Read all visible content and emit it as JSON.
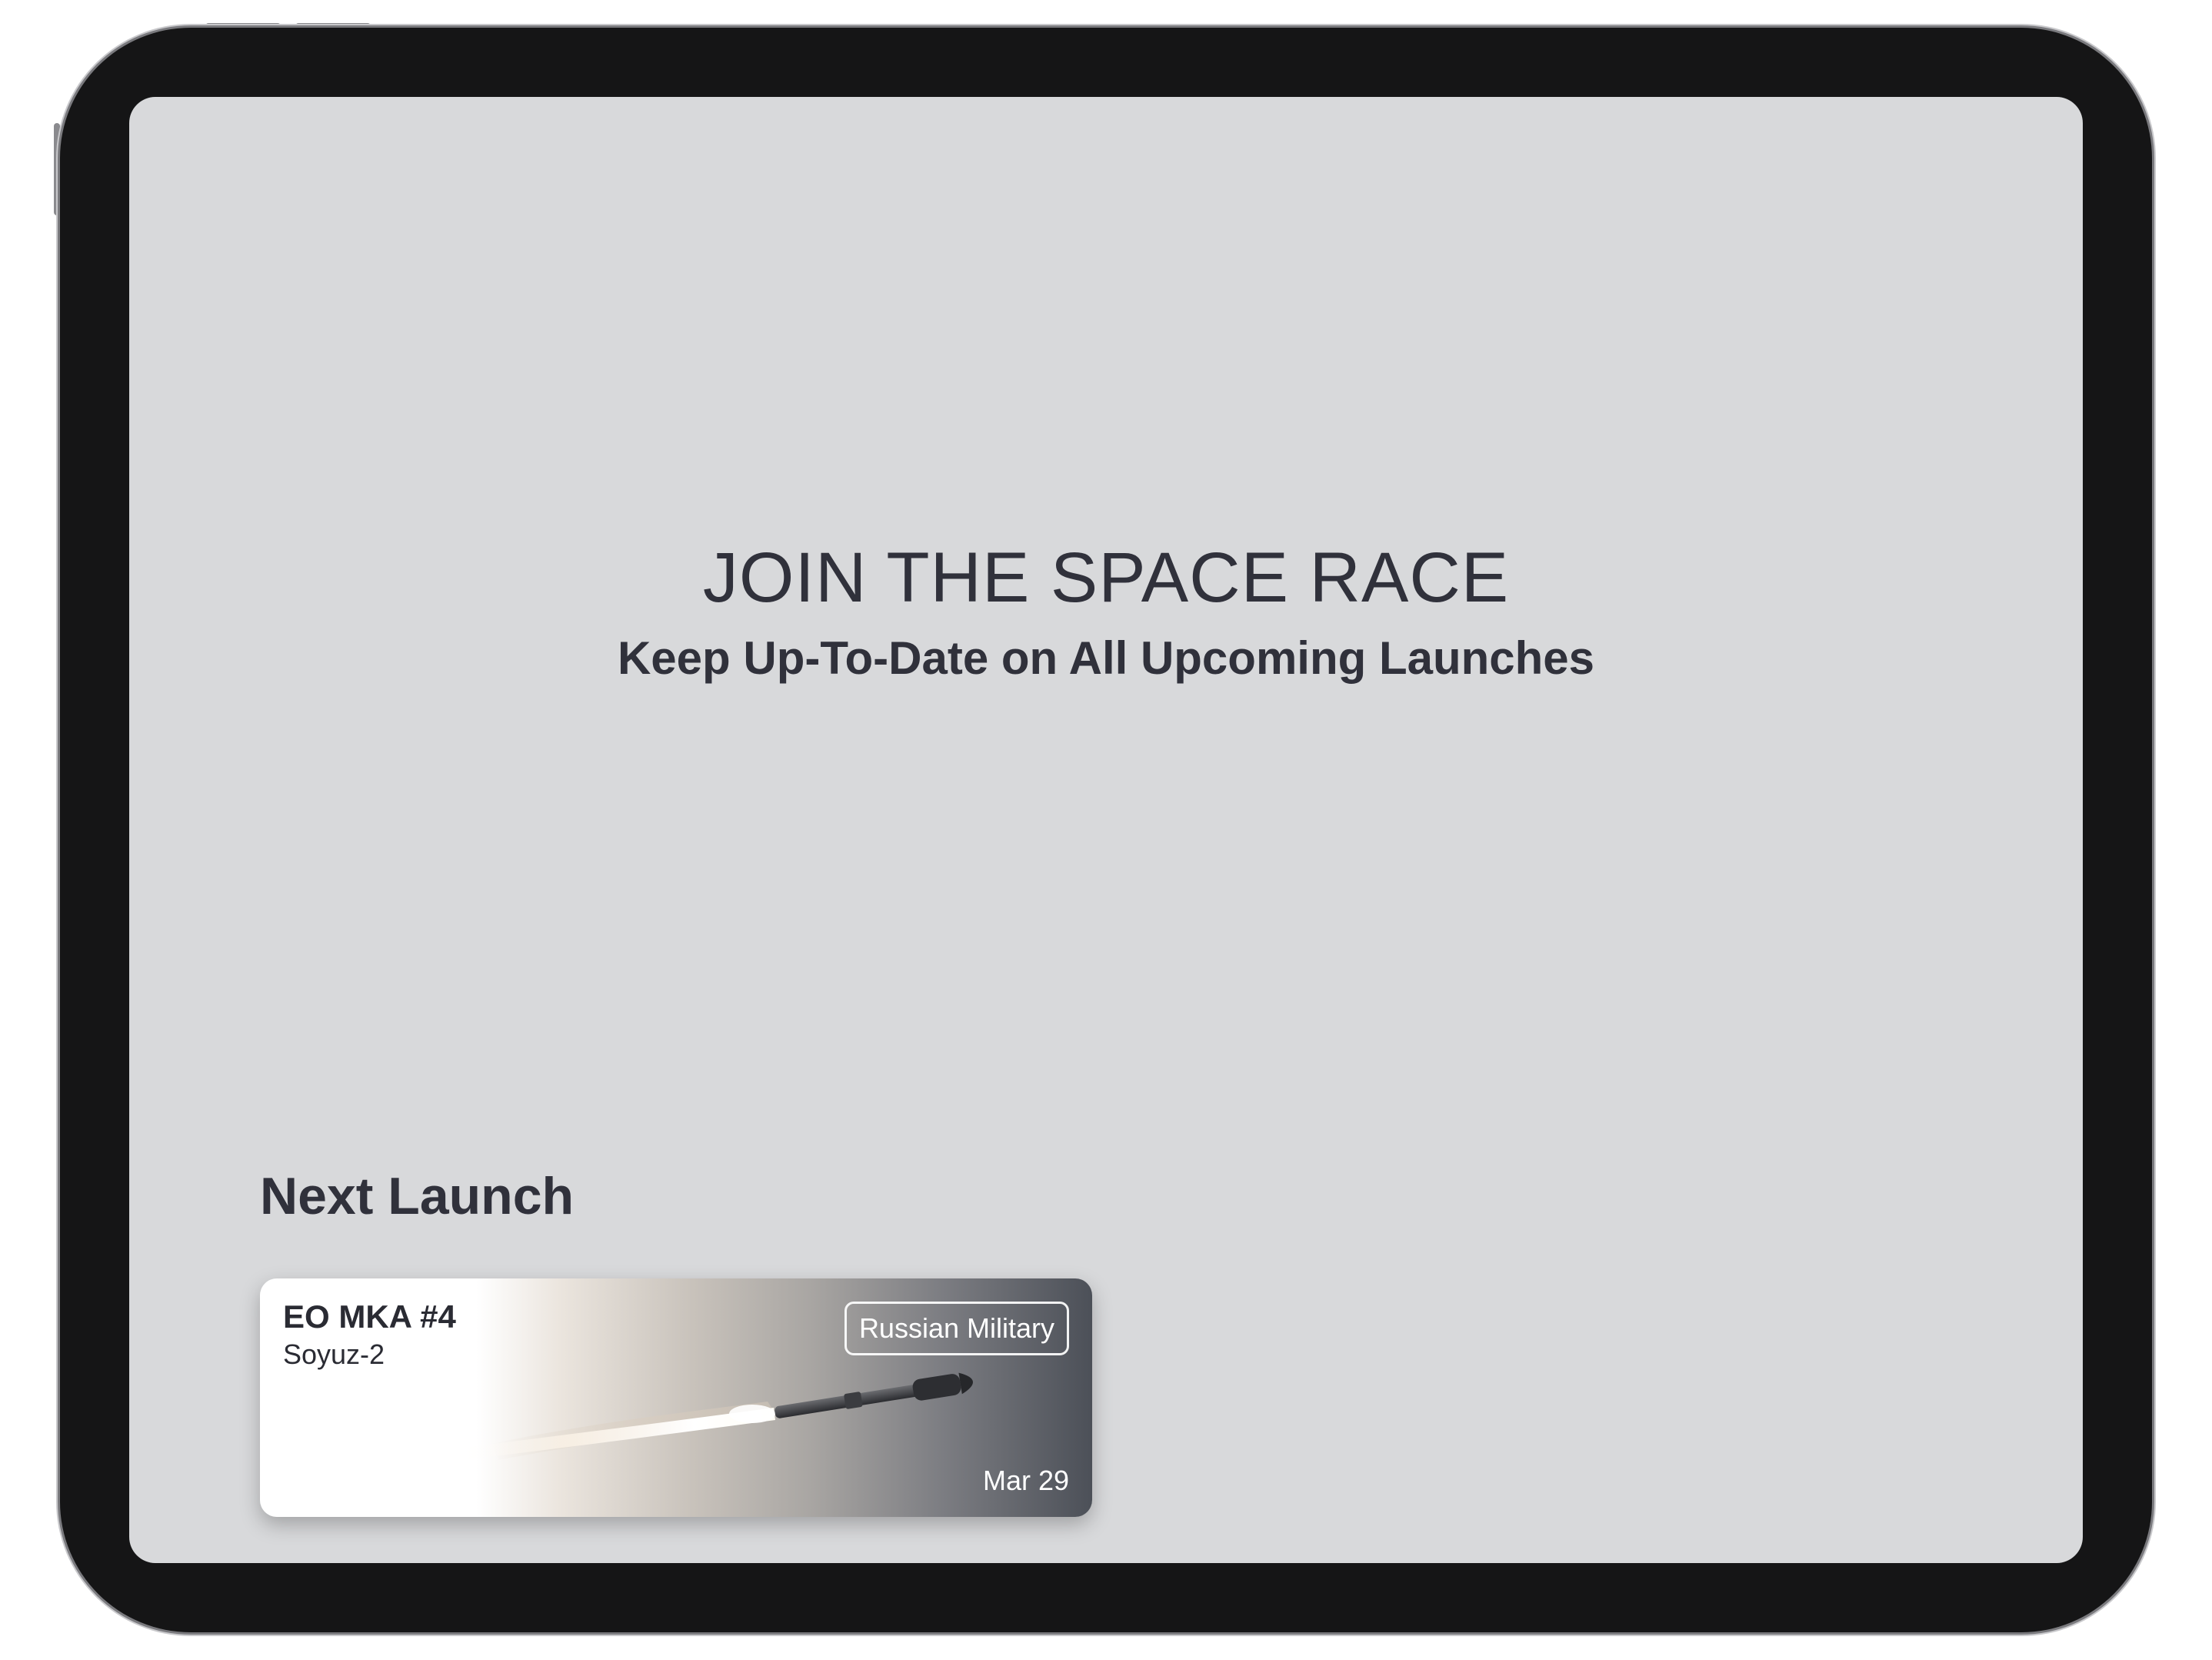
{
  "hero": {
    "title": "JOIN THE SPACE RACE",
    "subtitle": "Keep Up-To-Date on All Upcoming Launches"
  },
  "next_launch": {
    "section_title": "Next Launch",
    "card": {
      "mission": "EO MKA #4",
      "rocket": "Soyuz-2",
      "agency": "Russian Military",
      "date": "Mar 29",
      "image_icon": "rocket-launch-image"
    }
  },
  "colors": {
    "screen_background": "#d8d9db",
    "text_primary": "#30313b",
    "device_frame": "#151516"
  }
}
